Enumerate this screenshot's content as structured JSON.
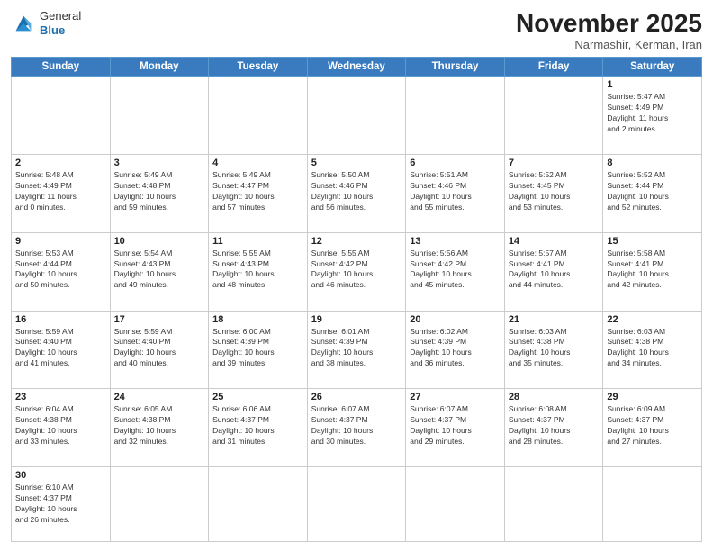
{
  "header": {
    "logo_general": "General",
    "logo_blue": "Blue",
    "month_title": "November 2025",
    "location": "Narmashir, Kerman, Iran"
  },
  "weekdays": [
    "Sunday",
    "Monday",
    "Tuesday",
    "Wednesday",
    "Thursday",
    "Friday",
    "Saturday"
  ],
  "weeks": [
    [
      {
        "day": "",
        "info": ""
      },
      {
        "day": "",
        "info": ""
      },
      {
        "day": "",
        "info": ""
      },
      {
        "day": "",
        "info": ""
      },
      {
        "day": "",
        "info": ""
      },
      {
        "day": "",
        "info": ""
      },
      {
        "day": "1",
        "info": "Sunrise: 5:47 AM\nSunset: 4:49 PM\nDaylight: 11 hours\nand 2 minutes."
      }
    ],
    [
      {
        "day": "2",
        "info": "Sunrise: 5:48 AM\nSunset: 4:49 PM\nDaylight: 11 hours\nand 0 minutes."
      },
      {
        "day": "3",
        "info": "Sunrise: 5:49 AM\nSunset: 4:48 PM\nDaylight: 10 hours\nand 59 minutes."
      },
      {
        "day": "4",
        "info": "Sunrise: 5:49 AM\nSunset: 4:47 PM\nDaylight: 10 hours\nand 57 minutes."
      },
      {
        "day": "5",
        "info": "Sunrise: 5:50 AM\nSunset: 4:46 PM\nDaylight: 10 hours\nand 56 minutes."
      },
      {
        "day": "6",
        "info": "Sunrise: 5:51 AM\nSunset: 4:46 PM\nDaylight: 10 hours\nand 55 minutes."
      },
      {
        "day": "7",
        "info": "Sunrise: 5:52 AM\nSunset: 4:45 PM\nDaylight: 10 hours\nand 53 minutes."
      },
      {
        "day": "8",
        "info": "Sunrise: 5:52 AM\nSunset: 4:44 PM\nDaylight: 10 hours\nand 52 minutes."
      }
    ],
    [
      {
        "day": "9",
        "info": "Sunrise: 5:53 AM\nSunset: 4:44 PM\nDaylight: 10 hours\nand 50 minutes."
      },
      {
        "day": "10",
        "info": "Sunrise: 5:54 AM\nSunset: 4:43 PM\nDaylight: 10 hours\nand 49 minutes."
      },
      {
        "day": "11",
        "info": "Sunrise: 5:55 AM\nSunset: 4:43 PM\nDaylight: 10 hours\nand 48 minutes."
      },
      {
        "day": "12",
        "info": "Sunrise: 5:55 AM\nSunset: 4:42 PM\nDaylight: 10 hours\nand 46 minutes."
      },
      {
        "day": "13",
        "info": "Sunrise: 5:56 AM\nSunset: 4:42 PM\nDaylight: 10 hours\nand 45 minutes."
      },
      {
        "day": "14",
        "info": "Sunrise: 5:57 AM\nSunset: 4:41 PM\nDaylight: 10 hours\nand 44 minutes."
      },
      {
        "day": "15",
        "info": "Sunrise: 5:58 AM\nSunset: 4:41 PM\nDaylight: 10 hours\nand 42 minutes."
      }
    ],
    [
      {
        "day": "16",
        "info": "Sunrise: 5:59 AM\nSunset: 4:40 PM\nDaylight: 10 hours\nand 41 minutes."
      },
      {
        "day": "17",
        "info": "Sunrise: 5:59 AM\nSunset: 4:40 PM\nDaylight: 10 hours\nand 40 minutes."
      },
      {
        "day": "18",
        "info": "Sunrise: 6:00 AM\nSunset: 4:39 PM\nDaylight: 10 hours\nand 39 minutes."
      },
      {
        "day": "19",
        "info": "Sunrise: 6:01 AM\nSunset: 4:39 PM\nDaylight: 10 hours\nand 38 minutes."
      },
      {
        "day": "20",
        "info": "Sunrise: 6:02 AM\nSunset: 4:39 PM\nDaylight: 10 hours\nand 36 minutes."
      },
      {
        "day": "21",
        "info": "Sunrise: 6:03 AM\nSunset: 4:38 PM\nDaylight: 10 hours\nand 35 minutes."
      },
      {
        "day": "22",
        "info": "Sunrise: 6:03 AM\nSunset: 4:38 PM\nDaylight: 10 hours\nand 34 minutes."
      }
    ],
    [
      {
        "day": "23",
        "info": "Sunrise: 6:04 AM\nSunset: 4:38 PM\nDaylight: 10 hours\nand 33 minutes."
      },
      {
        "day": "24",
        "info": "Sunrise: 6:05 AM\nSunset: 4:38 PM\nDaylight: 10 hours\nand 32 minutes."
      },
      {
        "day": "25",
        "info": "Sunrise: 6:06 AM\nSunset: 4:37 PM\nDaylight: 10 hours\nand 31 minutes."
      },
      {
        "day": "26",
        "info": "Sunrise: 6:07 AM\nSunset: 4:37 PM\nDaylight: 10 hours\nand 30 minutes."
      },
      {
        "day": "27",
        "info": "Sunrise: 6:07 AM\nSunset: 4:37 PM\nDaylight: 10 hours\nand 29 minutes."
      },
      {
        "day": "28",
        "info": "Sunrise: 6:08 AM\nSunset: 4:37 PM\nDaylight: 10 hours\nand 28 minutes."
      },
      {
        "day": "29",
        "info": "Sunrise: 6:09 AM\nSunset: 4:37 PM\nDaylight: 10 hours\nand 27 minutes."
      }
    ],
    [
      {
        "day": "30",
        "info": "Sunrise: 6:10 AM\nSunset: 4:37 PM\nDaylight: 10 hours\nand 26 minutes."
      },
      {
        "day": "",
        "info": ""
      },
      {
        "day": "",
        "info": ""
      },
      {
        "day": "",
        "info": ""
      },
      {
        "day": "",
        "info": ""
      },
      {
        "day": "",
        "info": ""
      },
      {
        "day": "",
        "info": ""
      }
    ]
  ]
}
